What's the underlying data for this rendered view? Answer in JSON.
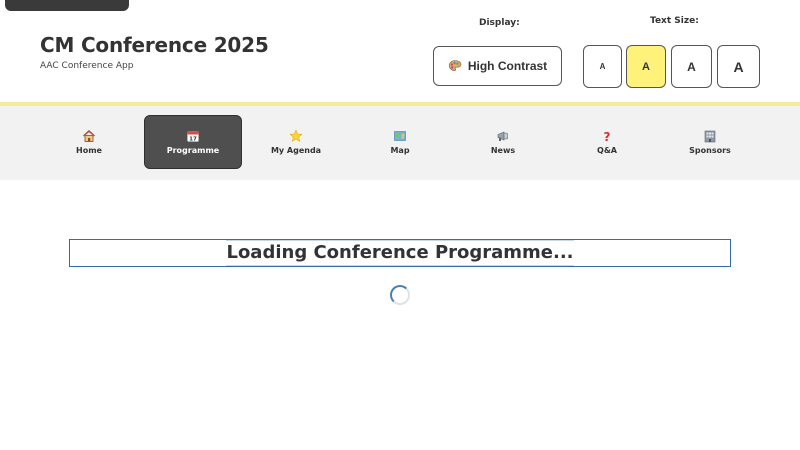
{
  "app": {
    "title": "CM Conference 2025",
    "subtitle": "AAC Conference App"
  },
  "display": {
    "label": "Display:",
    "high_contrast_label": "High Contrast",
    "high_contrast_icon": "palette-icon"
  },
  "text_size": {
    "label": "Text Size:",
    "options": [
      {
        "label": "A",
        "size": "small",
        "selected": false
      },
      {
        "label": "A",
        "size": "medium",
        "selected": true
      },
      {
        "label": "A",
        "size": "large",
        "selected": false
      },
      {
        "label": "A",
        "size": "extra-large",
        "selected": false
      }
    ]
  },
  "nav": {
    "items": [
      {
        "label": "Home",
        "icon": "house-icon",
        "active": false
      },
      {
        "label": "Programme",
        "icon": "calendar-icon",
        "active": true
      },
      {
        "label": "My Agenda",
        "icon": "star-icon",
        "active": false
      },
      {
        "label": "Map",
        "icon": "map-icon",
        "active": false
      },
      {
        "label": "News",
        "icon": "megaphone-icon",
        "active": false
      },
      {
        "label": "Q&A",
        "icon": "question-mark-icon",
        "active": false
      },
      {
        "label": "Sponsors",
        "icon": "building-icon",
        "active": false
      }
    ]
  },
  "main": {
    "loading_text": "Loading Conference Programme..."
  },
  "colors": {
    "accent_yellow": "#fff27a",
    "accent_line": "#f6eb9a",
    "nav_active_bg": "#4f4f4f",
    "focus_blue": "#2f6ea8",
    "text_dark": "#333333"
  }
}
